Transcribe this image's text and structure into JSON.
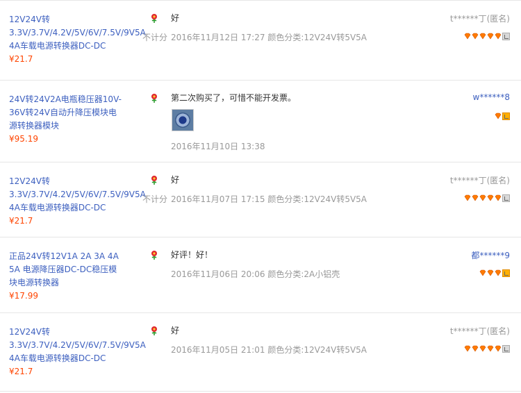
{
  "colors": {
    "link": "#3c5fbf",
    "price": "#ff4400",
    "meta": "#999999",
    "border": "#e6e6e6",
    "gem": "#ff7b00"
  },
  "reviews": [
    {
      "product_title": "12V24V转3.3V/3.7V/4.2V/5V/6V/7.5V/9V5A 4A车载电源转换器DC-DC",
      "price": "¥21.7",
      "comment": "好",
      "tag": "不计分",
      "date": "2016年11月12日 17:27",
      "sku": "颜色分类:12V24V转5V5A",
      "user": "t******丁(匿名)",
      "user_type": "anon",
      "gems": 5,
      "vip": "gray"
    },
    {
      "product_title": "24V转24V2A电瓶稳压器10V-36V转24V自动升降压模块电源转换器模块",
      "price": "¥95.19",
      "comment": "第二次购买了，可惜不能开发票。",
      "tag": "",
      "date": "2016年11月10日 13:38",
      "sku": "",
      "user": "w******8",
      "user_type": "named",
      "gems": 1,
      "vip": "orange",
      "has_photo": true
    },
    {
      "product_title": "12V24V转3.3V/3.7V/4.2V/5V/6V/7.5V/9V5A 4A车载电源转换器DC-DC",
      "price": "¥21.7",
      "comment": "好",
      "tag": "不计分",
      "date": "2016年11月07日 17:15",
      "sku": "颜色分类:12V24V转5V5A",
      "user": "t******丁(匿名)",
      "user_type": "anon",
      "gems": 5,
      "vip": "gray"
    },
    {
      "product_title": "正品24V转12V1A 2A 3A 4A 5A 电源降压器DC-DC稳压模块电源转换器",
      "price": "¥17.99",
      "comment": "好评！好！",
      "tag": "",
      "date": "2016年11月06日 20:06",
      "sku": "颜色分类:2A小铝壳",
      "user": "都******9",
      "user_type": "named",
      "gems": 3,
      "vip": "orange"
    },
    {
      "product_title": "12V24V转3.3V/3.7V/4.2V/5V/6V/7.5V/9V5A 4A车载电源转换器DC-DC",
      "price": "¥21.7",
      "comment": "好",
      "tag": "",
      "date": "2016年11月05日 21:01",
      "sku": "颜色分类:12V24V转5V5A",
      "user": "t******丁(匿名)",
      "user_type": "anon",
      "gems": 5,
      "vip": "gray"
    }
  ]
}
